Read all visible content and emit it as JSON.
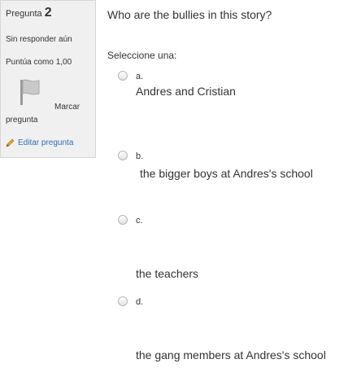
{
  "info": {
    "question_word": "Pregunta",
    "question_number": "2",
    "state": "Sin responder aún",
    "grade": "Puntúa como 1,00",
    "flag_word1": "Marcar",
    "flag_word2": "pregunta",
    "edit_label": "Editar pregunta"
  },
  "question": {
    "text": "Who are the bullies in this story?",
    "prompt": "Seleccione una:",
    "options": [
      {
        "letter": "a.",
        "text": "Andres and Cristian"
      },
      {
        "letter": "b.",
        "text": "the bigger boys at Andres's school"
      },
      {
        "letter": "c.",
        "text": "the teachers"
      },
      {
        "letter": "d.",
        "text": "the gang members at Andres's school"
      }
    ]
  },
  "colors": {
    "panel_bg": "#f0f0f0",
    "link": "#2e6fb3",
    "text": "#333333"
  }
}
